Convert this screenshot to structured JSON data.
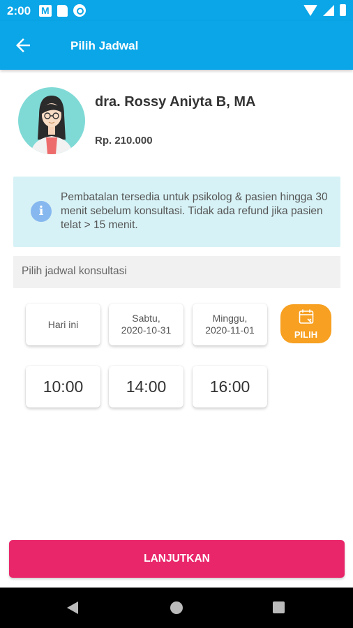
{
  "status_bar": {
    "time": "2:00",
    "icons_left": [
      "gmail-icon",
      "sd-card-icon",
      "sync-icon"
    ],
    "icons_right": [
      "wifi-icon",
      "signal-icon",
      "battery-icon"
    ]
  },
  "app_bar": {
    "title": "Pilih Jadwal",
    "back_icon": "arrow-left-icon",
    "color": "#0aa6e8"
  },
  "doctor": {
    "name": "dra. Rossy Aniyta B, MA",
    "price": "Rp. 210.000",
    "avatar_icon": "doctor-avatar"
  },
  "info": {
    "icon": "info-icon",
    "text": "Pembatalan tersedia untuk psikolog & pasien hingga 30 menit sebelum konsultasi. Tidak ada refund jika pasien telat > 15 menit."
  },
  "schedule": {
    "label": "Pilih jadwal konsultasi",
    "dates": [
      {
        "line1": "Hari ini",
        "line2": ""
      },
      {
        "line1": "Sabtu,",
        "line2": "2020-10-31"
      },
      {
        "line1": "Minggu,",
        "line2": "2020-11-01"
      }
    ],
    "pick_button": {
      "label": "PILIH",
      "icon": "calendar-icon",
      "color": "#f7a021"
    },
    "times": [
      "10:00",
      "14:00",
      "16:00"
    ]
  },
  "footer": {
    "button_label": "LANJUTKAN",
    "color": "#e9266a"
  },
  "nav": {
    "icons": [
      "nav-back-icon",
      "nav-home-icon",
      "nav-recents-icon"
    ]
  }
}
